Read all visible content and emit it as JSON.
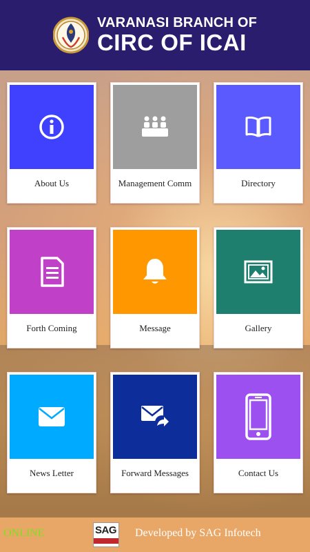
{
  "header": {
    "title_line1": "VARANASI BRANCH OF",
    "title_line2": "CIRC OF ICAI",
    "background": "#2a1d6e"
  },
  "tiles": [
    {
      "label": "About Us",
      "icon": "info-icon",
      "color": "#4040ff"
    },
    {
      "label": "Management Comm",
      "icon": "meeting-icon",
      "color": "#9e9e9e"
    },
    {
      "label": "Directory",
      "icon": "book-icon",
      "color": "#5a5aff"
    },
    {
      "label": "Forth Coming",
      "icon": "document-icon",
      "color": "#c040c8"
    },
    {
      "label": "Message",
      "icon": "bell-icon",
      "color": "#ff9800"
    },
    {
      "label": "Gallery",
      "icon": "picture-icon",
      "color": "#1f7f6e"
    },
    {
      "label": "News Letter",
      "icon": "envelope-icon",
      "color": "#00aaff"
    },
    {
      "label": "Forward Messages",
      "icon": "forward-mail-icon",
      "color": "#0d2d9a"
    },
    {
      "label": "Contact Us",
      "icon": "phone-icon",
      "color": "#9c50f0"
    }
  ],
  "footer": {
    "status": "ONLINE",
    "brand_logo_text": "SAG",
    "developer_text": "Developed by SAG Infotech",
    "status_color": "#80e020",
    "background": "#e8a767"
  }
}
